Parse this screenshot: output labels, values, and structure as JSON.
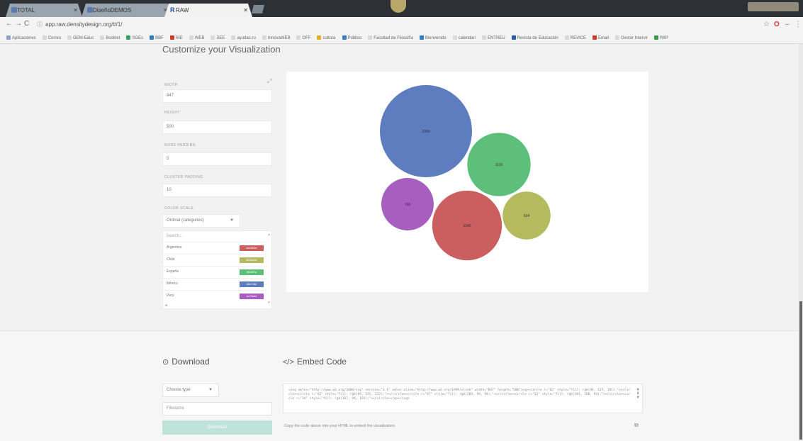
{
  "browser": {
    "tabs": [
      {
        "title": "TOTAL"
      },
      {
        "title": "DiseñoDEMOS"
      },
      {
        "title": "RAW",
        "fav": "R"
      }
    ],
    "url": "app.raw.densitydesign.org/#/1/",
    "bookmarks": [
      {
        "label": "Aplicaciones",
        "color": "#8aa4c8"
      },
      {
        "label": "Correo",
        "color": "#d9d9d9"
      },
      {
        "label": "GEM-Educ",
        "color": "#d9d9d9"
      },
      {
        "label": "Booklet",
        "color": "#d9d9d9"
      },
      {
        "label": "SGEs",
        "color": "#3aa05a"
      },
      {
        "label": "BBF",
        "color": "#2a7cc9"
      },
      {
        "label": "RIE",
        "color": "#cc3a2a"
      },
      {
        "label": "WEB",
        "color": "#d9d9d9"
      },
      {
        "label": "SEE",
        "color": "#d9d9d9"
      },
      {
        "label": "ayudas.ru",
        "color": "#d9d9d9"
      },
      {
        "label": "InnovaWEB",
        "color": "#d9d9d9"
      },
      {
        "label": "OFF",
        "color": "#d9d9d9"
      },
      {
        "label": "cultura",
        "color": "#e0b020"
      },
      {
        "label": "Público",
        "color": "#3a7cc9"
      },
      {
        "label": "Facultad de Filosofía",
        "color": "#d9d9d9"
      },
      {
        "label": "Bienvenido",
        "color": "#2a7cc9"
      },
      {
        "label": "calendari",
        "color": "#d9d9d9"
      },
      {
        "label": "ENTREU",
        "color": "#d9d9d9"
      },
      {
        "label": "Revista de Educación",
        "color": "#2a5aa0"
      },
      {
        "label": "REVICE",
        "color": "#d9d9d9"
      },
      {
        "label": "Email",
        "color": "#cc3a2a"
      },
      {
        "label": "Gestor Intervir",
        "color": "#d9d9d9"
      },
      {
        "label": "RIIP",
        "color": "#3a9a4a"
      }
    ]
  },
  "options": {
    "title": "Customize your Visualization",
    "width_label": "WIDTH",
    "width_value": "847",
    "height_label": "HEIGHT",
    "height_value": "500",
    "node_padding_label": "NODE PADDING",
    "node_padding_value": "5",
    "cluster_padding_label": "CLUSTER PADDING",
    "cluster_padding_value": "10",
    "color_scale_label": "COLOR SCALE",
    "color_scale_value": "Ordinal (categories)",
    "search_placeholder": "Search...",
    "colors": [
      {
        "name": "Argentina",
        "hex": "#cb5e5e"
      },
      {
        "name": "Chile",
        "hex": "#b5ba5e"
      },
      {
        "name": "España",
        "hex": "#5ebf7a"
      },
      {
        "name": "México",
        "hex": "#5e7dbf"
      },
      {
        "name": "Perú",
        "hex": "#a75ebf"
      }
    ]
  },
  "chart_data": {
    "type": "bubble",
    "nodes": [
      {
        "label": "2350",
        "category": "México",
        "value": 2350
      },
      {
        "label": "1110",
        "category": "España",
        "value": 1110
      },
      {
        "label": "760",
        "category": "Perú",
        "value": 760
      },
      {
        "label": "1345",
        "category": "Argentina",
        "value": 1345
      },
      {
        "label": "634",
        "category": "Chile",
        "value": 634
      }
    ]
  },
  "download": {
    "title": "Download",
    "type_placeholder": "Choose type",
    "filename_placeholder": "Filename",
    "button_label": "Download"
  },
  "embed": {
    "title": "Embed Code",
    "code": "<svg xmlns=\"http://www.w3.org/2000/svg\" version=\"1.1\" xmlns:xlink=\"http://www.w3.org/1999/xlink\" width=\"847\" height=\"500\"><g><circle r=\"62\" style=\"fill: rgb(94, 125, 191);\"></circle><circle r=\"43\" style=\"fill: rgb(94, 191, 122);\"></circle><circle r=\"47\" style=\"fill: rgb(203, 94, 94);\"></circle><circle r=\"32\" style=\"fill: rgb(181, 186, 94);\"></circle><circle r=\"34\" style=\"fill: rgb(167, 94, 191);\"></circle></g></svg>",
    "hint": "Copy the code above into your HTML to embed the visualization."
  }
}
